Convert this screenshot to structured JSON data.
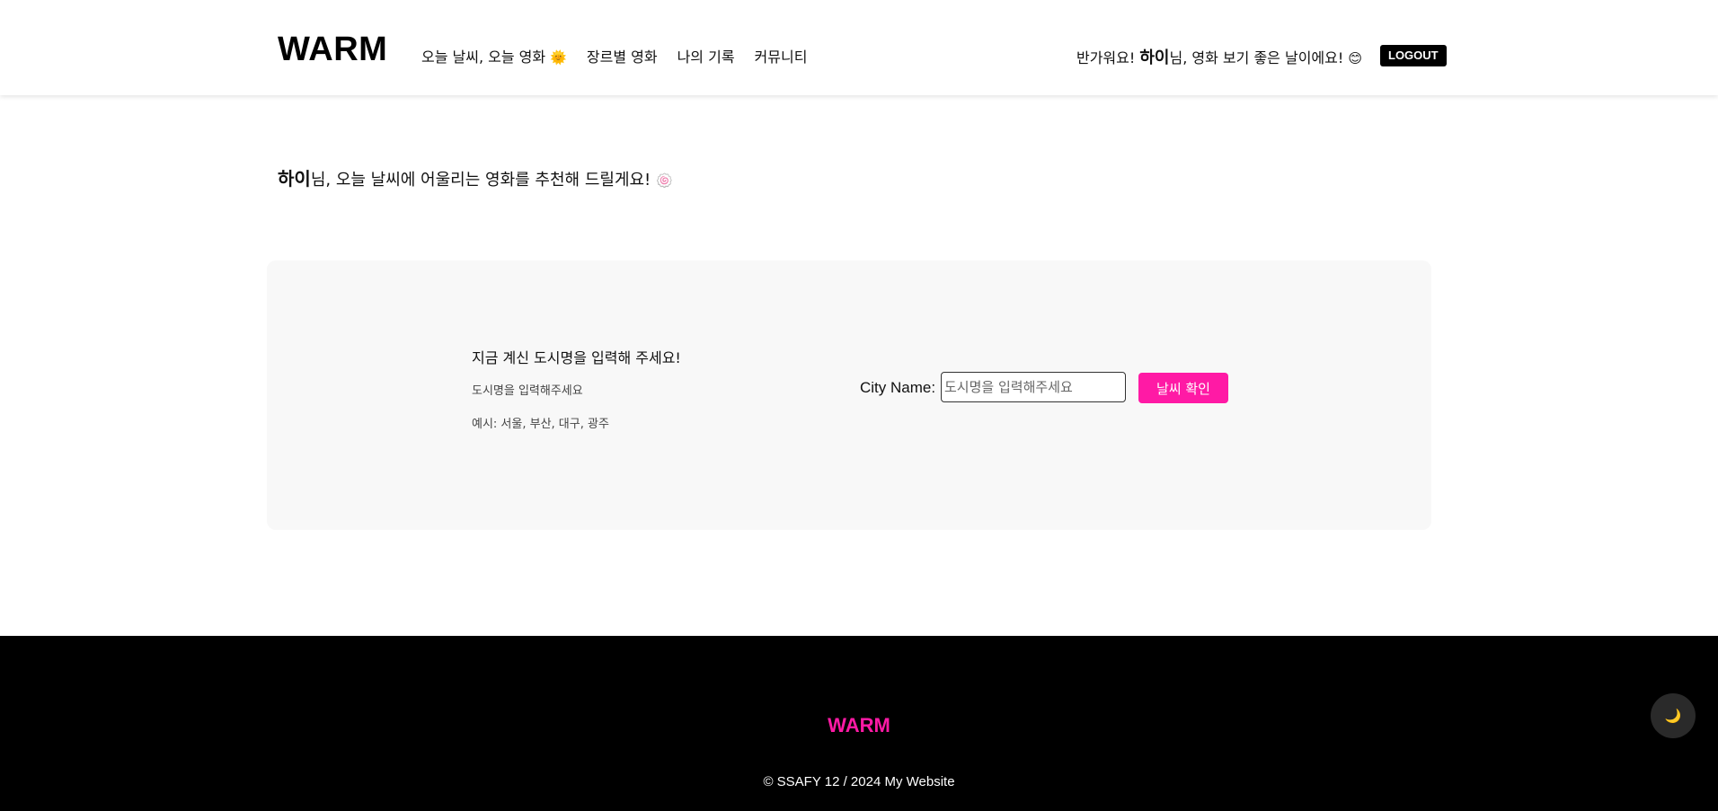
{
  "header": {
    "logo": "WARM",
    "nav": [
      {
        "label": "오늘 날씨, 오늘 영화",
        "emoji": "🌞"
      },
      {
        "label": "장르별 영화"
      },
      {
        "label": "나의 기록"
      },
      {
        "label": "커뮤니티"
      }
    ],
    "greeting": {
      "prefix": "반가워요! ",
      "user": "하이",
      "suffix": "님, 영화 보기 좋은 날이에요! ",
      "emoji": "😊"
    },
    "logout_label": "LOGOUT"
  },
  "main": {
    "headline": {
      "user": "하이",
      "text": "님, 오늘 날씨에 어울리는 영화를 추천해 드릴게요! ",
      "emoji": "🍥"
    },
    "panel": {
      "title": "지금 계신 도시명을 입력해 주세요!",
      "subtitle": "도시명을 입력해주세요",
      "example": "예시: 서울, 부산, 대구, 광주",
      "city_label": "City Name:",
      "input_placeholder": "도시명을 입력해주세요",
      "input_value": "",
      "button_label": "날씨 확인"
    }
  },
  "footer": {
    "logo": "WARM",
    "copyright": "© SSAFY 12 / 2024 My Website"
  },
  "theme_toggle": {
    "icon": "moon-icon",
    "glyph": "🌙"
  },
  "colors": {
    "accent": "#ff1aa5",
    "footer_bg": "#000000",
    "panel_bg": "#f8f8f8"
  }
}
